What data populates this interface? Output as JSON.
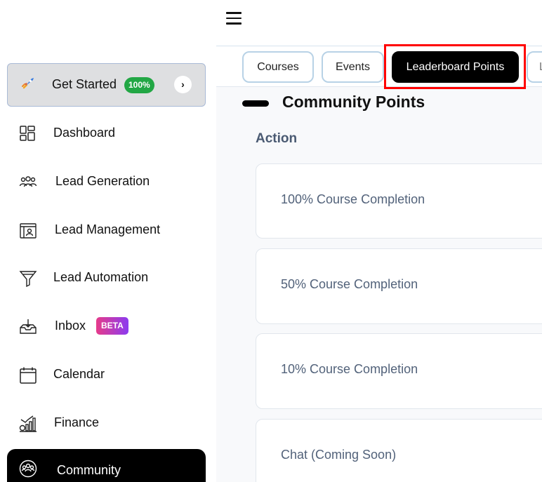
{
  "sidebar": {
    "get_started": {
      "label": "Get Started",
      "badge": "100%",
      "chevron": "›"
    },
    "items": [
      {
        "label": "Dashboard",
        "icon": "dashboard-icon"
      },
      {
        "label": "Lead Generation",
        "icon": "users-group-icon"
      },
      {
        "label": "Lead Management",
        "icon": "contact-card-icon"
      },
      {
        "label": "Lead Automation",
        "icon": "funnel-icon"
      },
      {
        "label": "Inbox",
        "icon": "inbox-icon",
        "badge": "BETA"
      },
      {
        "label": "Calendar",
        "icon": "calendar-icon"
      },
      {
        "label": "Finance",
        "icon": "finance-chart-icon"
      },
      {
        "label": "Community",
        "icon": "community-icon",
        "active": true
      }
    ]
  },
  "tabs": [
    {
      "label": "Courses"
    },
    {
      "label": "Events"
    },
    {
      "label": "Leaderboard Points",
      "active": true
    },
    {
      "label": "L"
    }
  ],
  "section": {
    "title": "Community Points",
    "column_header": "Action"
  },
  "actions": [
    {
      "label": "100% Course Completion"
    },
    {
      "label": "50% Course Completion"
    },
    {
      "label": "10% Course Completion"
    },
    {
      "label": "Chat (Coming Soon)"
    }
  ],
  "colors": {
    "active_bg": "#000000",
    "badge_green": "#22a745",
    "highlight": "#ff0000",
    "tab_border": "#b8d2e6"
  }
}
